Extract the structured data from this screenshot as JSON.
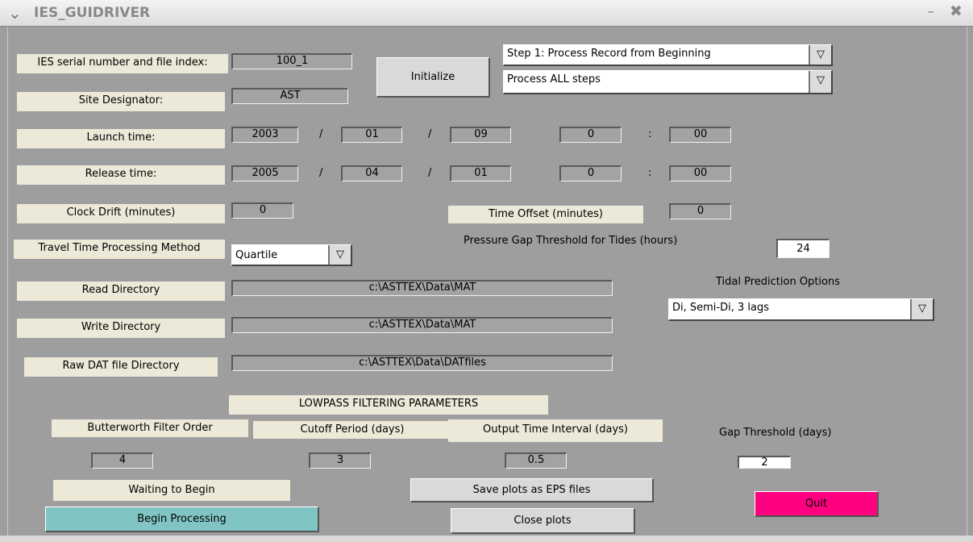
{
  "window": {
    "title": "IES_GUIDRIVER",
    "menu_glyph": "⌄",
    "minimize_glyph": "–",
    "close_glyph": "✖"
  },
  "serial": {
    "label": "IES serial number and file index:",
    "value": "100_1"
  },
  "site": {
    "label": "Site Designator:",
    "value": "AST"
  },
  "initialize_button": "Initialize",
  "step_dropdown": {
    "value": "Step 1: Process Record from Beginning",
    "arrow": "▽"
  },
  "steps_dropdown": {
    "value": "Process ALL steps",
    "arrow": "▽"
  },
  "launch": {
    "label": "Launch time:",
    "year": "2003",
    "month": "01",
    "day": "09",
    "hour": "0",
    "minute": "00"
  },
  "release": {
    "label": "Release time:",
    "year": "2005",
    "month": "04",
    "day": "01",
    "hour": "0",
    "minute": "00"
  },
  "separators": {
    "date": "/",
    "time": ":"
  },
  "clock_drift": {
    "label": "Clock Drift (minutes)",
    "value": "0"
  },
  "time_offset": {
    "label": "Time Offset  (minutes)",
    "value": "0"
  },
  "travel_time": {
    "label": "Travel Time Processing Method",
    "value": "Quartile",
    "arrow": "▽"
  },
  "pressure_gap": {
    "label": "Pressure Gap Threshold for Tides  (hours)",
    "value": "24"
  },
  "tidal": {
    "label": "Tidal Prediction Options",
    "value": "Di, Semi-Di, 3 lags",
    "arrow": "▽"
  },
  "read_dir": {
    "label": "Read Directory",
    "value": "c:\\ASTTEX\\Data\\MAT"
  },
  "write_dir": {
    "label": "Write Directory",
    "value": "c:\\ASTTEX\\Data\\MAT"
  },
  "raw_dir": {
    "label": "Raw DAT file Directory",
    "value": "c:\\ASTTEX\\Data\\DATfiles"
  },
  "lowpass": {
    "header": "LOWPASS FILTERING PARAMETERS",
    "butterworth_label": "Butterworth Filter Order",
    "butterworth_value": "4",
    "cutoff_label": "Cutoff Period (days)",
    "cutoff_value": "3",
    "output_label": "Output Time  Interval (days)",
    "output_value": "0.5",
    "gap_label": "Gap Threshold (days)",
    "gap_value": "2"
  },
  "status": "Waiting to Begin",
  "save_eps_button": "Save plots as EPS files",
  "close_plots_button": "Close plots",
  "begin_button": "Begin Processing",
  "quit_button": "Quit",
  "colors": {
    "begin": "#80c4c4",
    "quit": "#ff0080",
    "background": "#9e9e9e",
    "label_bg": "#ece9d8"
  }
}
